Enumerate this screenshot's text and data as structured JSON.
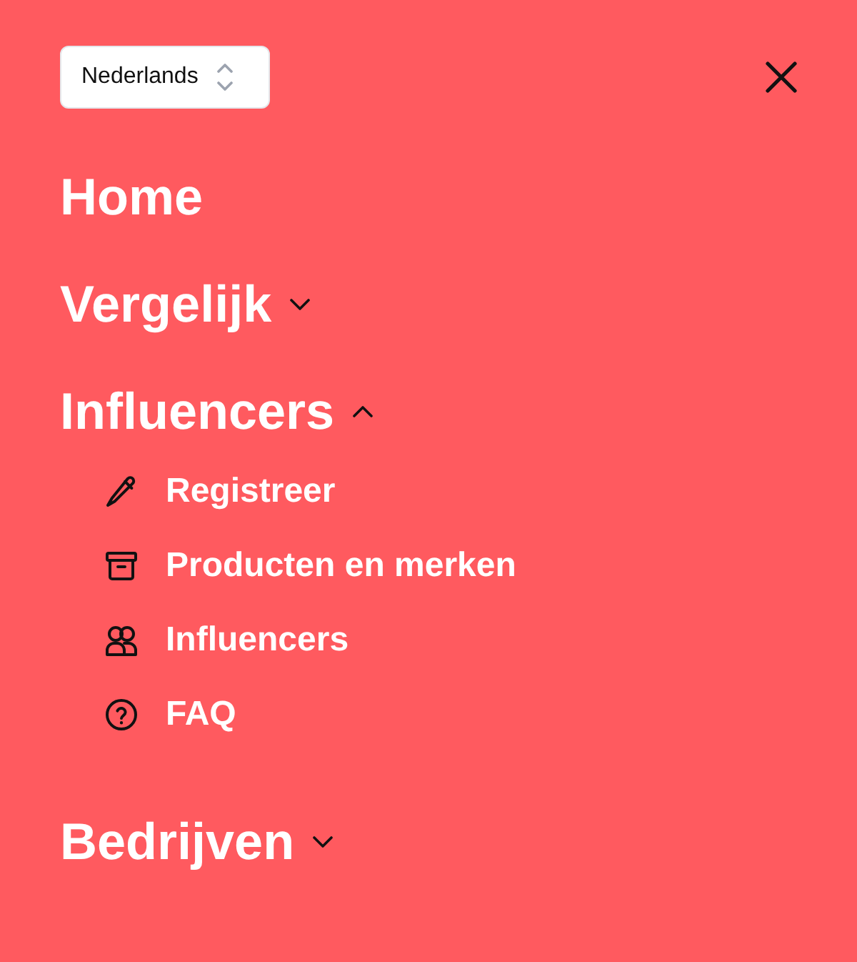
{
  "language_select": {
    "value": "Nederlands"
  },
  "nav": [
    {
      "kind": "link",
      "label": "Home"
    },
    {
      "kind": "group",
      "label": "Vergelijk",
      "expanded": false
    },
    {
      "kind": "group",
      "label": "Influencers",
      "expanded": true,
      "children": [
        {
          "label": "Registreer"
        },
        {
          "label": "Producten en merken"
        },
        {
          "label": "Influencers"
        },
        {
          "label": "FAQ"
        }
      ]
    },
    {
      "kind": "group",
      "label": "Bedrijven",
      "expanded": false
    }
  ]
}
